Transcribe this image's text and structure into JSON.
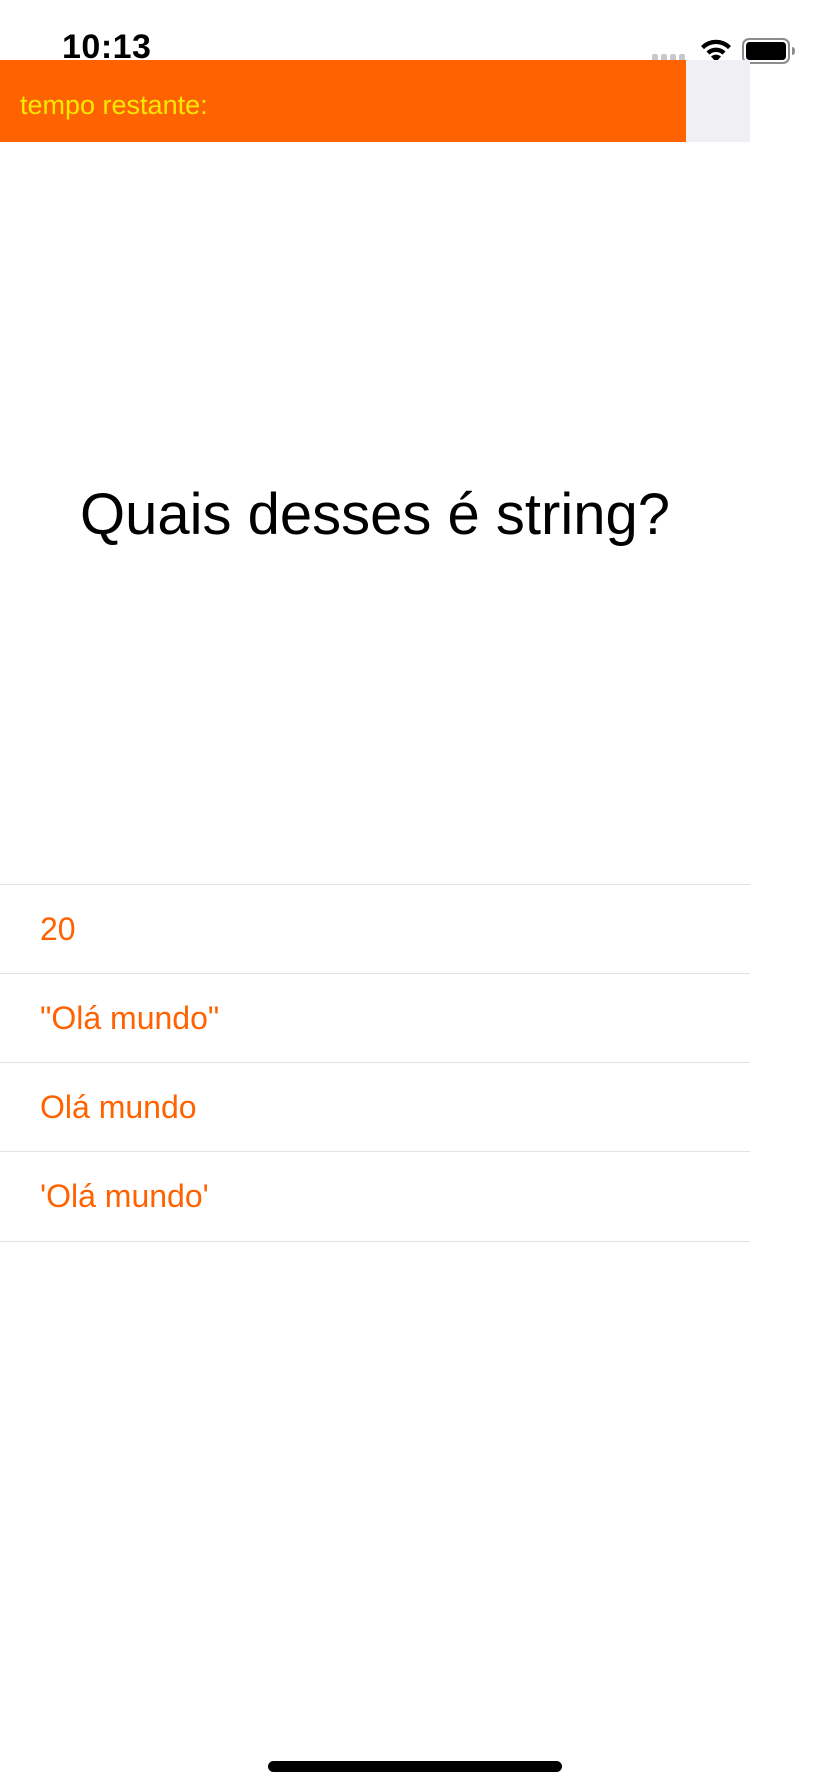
{
  "status_bar": {
    "time": "10:13",
    "wifi_icon": "wifi-icon",
    "battery_icon": "battery-icon",
    "signal_icon": "signal-icon"
  },
  "timer": {
    "label": "tempo restante:",
    "remaining_fraction": 0.915,
    "fill_color": "#ff6200",
    "track_color": "#efeff4",
    "label_color": "#f4e900"
  },
  "question": {
    "text": "Quais desses é string?"
  },
  "answers": [
    {
      "label": "20"
    },
    {
      "label": "\"Olá mundo\""
    },
    {
      "label": "Olá mundo"
    },
    {
      "label": "'Olá mundo'"
    }
  ],
  "colors": {
    "accent": "#ff6200",
    "separator": "#e2e2e6"
  }
}
